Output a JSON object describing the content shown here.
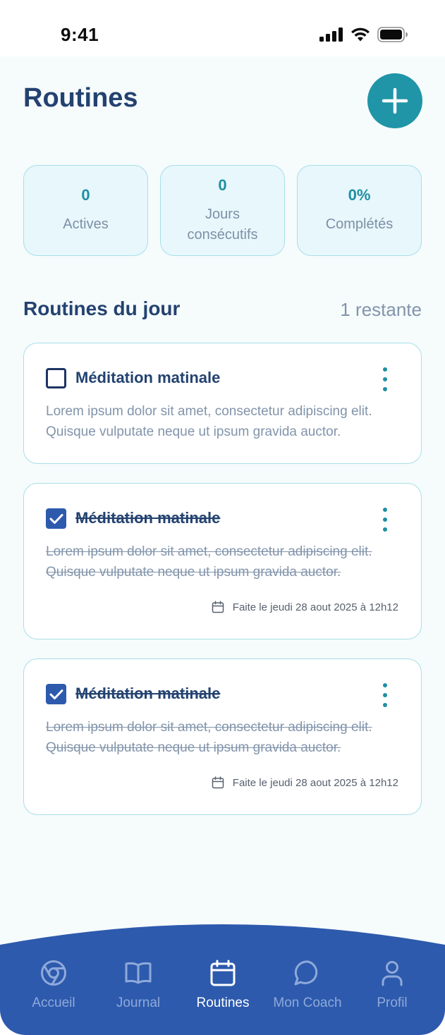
{
  "status_bar": {
    "time": "9:41"
  },
  "header": {
    "title": "Routines"
  },
  "stats": [
    {
      "value": "0",
      "label": "Actives"
    },
    {
      "value": "0",
      "label": "Jours consécutifs"
    },
    {
      "value": "0%",
      "label": "Complétés"
    }
  ],
  "section": {
    "title": "Routines du jour",
    "count": "1 restante"
  },
  "routines": [
    {
      "title": "Méditation matinale",
      "description": "Lorem ipsum dolor sit amet, consectetur adipiscing elit. Quisque vulputate neque ut ipsum gravida auctor.",
      "checked": false
    },
    {
      "title": "Méditation matinale",
      "description": "Lorem ipsum dolor sit amet, consectetur adipiscing elit. Quisque vulputate neque ut ipsum gravida auctor.",
      "checked": true,
      "done_text": "Faite le jeudi 28 aout 2025 à 12h12"
    },
    {
      "title": "Méditation matinale",
      "description": "Lorem ipsum dolor sit amet, consectetur adipiscing elit. Quisque vulputate neque ut ipsum gravida auctor.",
      "checked": true,
      "done_text": "Faite le jeudi 28 aout 2025 à 12h12"
    }
  ],
  "nav": [
    {
      "label": "Accueil",
      "icon": "chrome-icon",
      "active": false
    },
    {
      "label": "Journal",
      "icon": "book-icon",
      "active": false
    },
    {
      "label": "Routines",
      "icon": "calendar-icon",
      "active": true
    },
    {
      "label": "Mon Coach",
      "icon": "chat-bubble-icon",
      "active": false
    },
    {
      "label": "Profil",
      "icon": "user-icon",
      "active": false
    }
  ],
  "colors": {
    "primary": "#2d5aad",
    "accent": "#1f95a7",
    "title": "#234270",
    "muted": "#8294ab",
    "card_border": "#a8dfea",
    "stat_bg": "#e7f7fb"
  }
}
